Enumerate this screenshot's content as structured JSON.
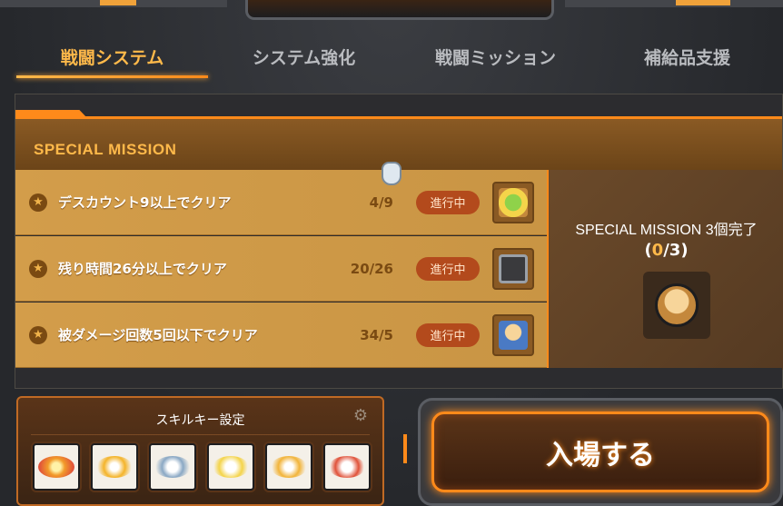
{
  "tabs": [
    {
      "label": "戦闘システム",
      "active": true
    },
    {
      "label": "システム強化",
      "active": false
    },
    {
      "label": "戦闘ミッション",
      "active": false
    },
    {
      "label": "補給品支援",
      "active": false
    }
  ],
  "mission_panel": {
    "title": "SPECIAL MISSION",
    "missions": [
      {
        "label": "デスカウント9以上でクリア",
        "progress": "4/9",
        "status": "進行中",
        "reward_icon": "gift-box-icon"
      },
      {
        "label": "残り時間26分以上でクリア",
        "progress": "20/26",
        "status": "進行中",
        "reward_icon": "monitor-character-icon"
      },
      {
        "label": "被ダメージ回数5回以下でクリア",
        "progress": "34/5",
        "status": "進行中",
        "reward_icon": "character-card-icon"
      }
    ],
    "summary": {
      "title": "SPECIAL MISSION 3個完了",
      "count_open": "(",
      "count_done": "0",
      "count_sep": "/3",
      "count_close": ")",
      "reward_icon": "character-medal-icon"
    }
  },
  "skill_panel": {
    "title": "スキルキー設定",
    "gear_icon": "gear-icon",
    "skills": [
      {
        "icon": "fireball-skill-icon",
        "color": "#f29a2a"
      },
      {
        "icon": "flame-dash-skill-icon",
        "color": "#f4b42a"
      },
      {
        "icon": "shield-push-skill-icon",
        "color": "#8aa8c4"
      },
      {
        "icon": "light-burst-skill-icon",
        "color": "#f4d44a"
      },
      {
        "icon": "slash-skill-icon",
        "color": "#f2b43a"
      },
      {
        "icon": "fire-punch-skill-icon",
        "color": "#e0523a"
      }
    ]
  },
  "enter_button": {
    "label": "入場する"
  },
  "colors": {
    "accent": "#ff8a1a",
    "gold": "#ffb94a",
    "badge": "#b34a1c"
  }
}
